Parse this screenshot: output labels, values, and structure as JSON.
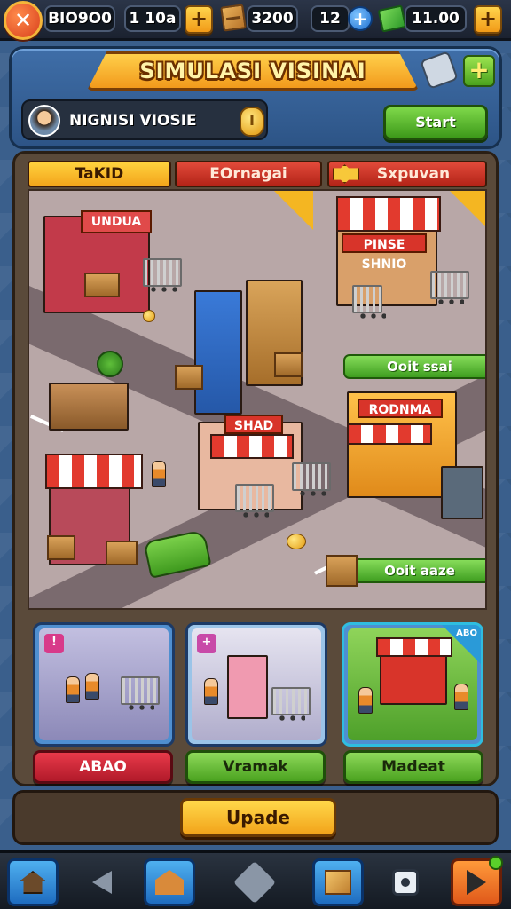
{
  "resources": {
    "coins_value": "BIO9O0",
    "gems_value": "1 10a",
    "crates_value": "3200",
    "energy_value": "12",
    "cash_value": "11.00",
    "cancel_glyph": "✕",
    "plus_glyph": "+"
  },
  "header": {
    "title": "SIMULASI VISINAI",
    "profile_name": "NIGNISI VIOSIE",
    "coin_badge": "I",
    "start_label": "Start",
    "plus_glyph": "+"
  },
  "tabs": [
    {
      "label": "TaKID"
    },
    {
      "label": "EOrnagai"
    },
    {
      "label": "Sxpuvan"
    }
  ],
  "map": {
    "shops": [
      {
        "sign": "UNDUA"
      },
      {
        "sign": "PINSE SHNIO"
      },
      {
        "sign": "SHAD"
      },
      {
        "sign": "RODNMA"
      }
    ],
    "label_buttons": [
      {
        "label": "Ooit ssai"
      },
      {
        "label": "Ooit aaze"
      }
    ]
  },
  "cards": [
    {
      "badge": "!",
      "ribbon": "",
      "button_label": "ABAO"
    },
    {
      "badge": "+",
      "ribbon": "",
      "button_label": "Vramak"
    },
    {
      "badge": "",
      "ribbon": "ABO",
      "button_label": "Madeat"
    }
  ],
  "upgrade": {
    "label": "Upade"
  },
  "nav": {
    "items": [
      "home-icon",
      "back-icon",
      "shop-icon",
      "diamond-icon",
      "crate-icon",
      "settings-icon",
      "play-icon"
    ]
  },
  "colors": {
    "accent_orange": "#f29a1c",
    "button_green": "#4aa21d",
    "button_red": "#b11a2a",
    "panel_blue": "#2d5486"
  }
}
